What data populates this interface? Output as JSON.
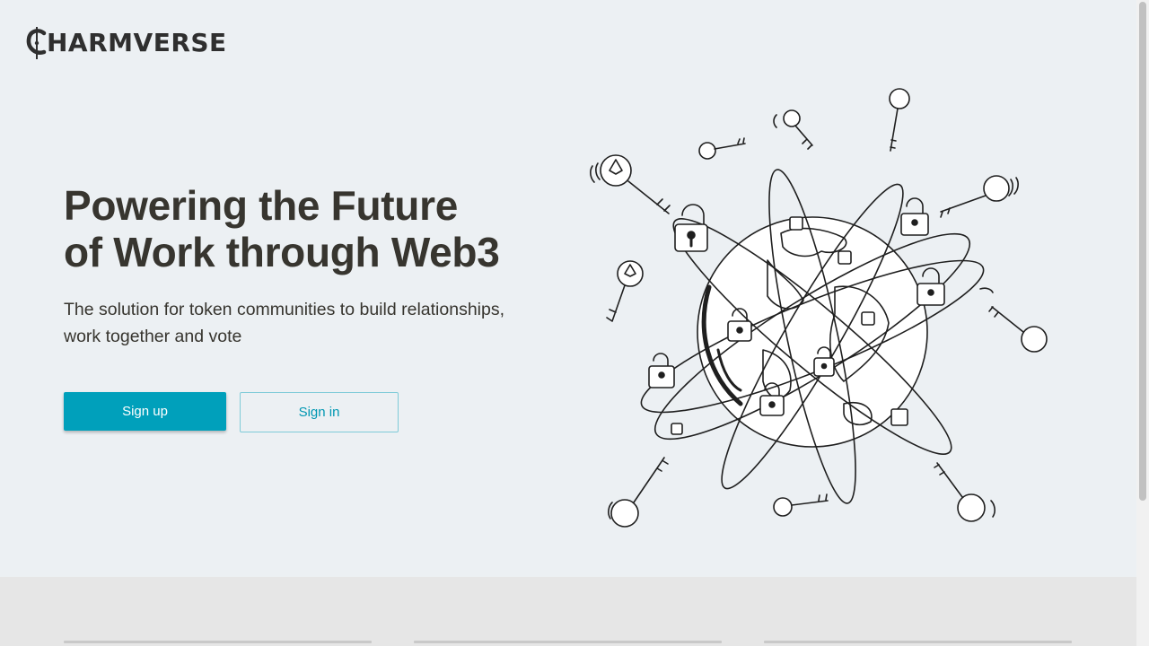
{
  "brand": {
    "logo_text": "HARMVERSE"
  },
  "hero": {
    "headline_line1": "Powering the Future",
    "headline_line2": "of Work through Web3",
    "subhead_line1": "The solution for token communities to build relationships,",
    "subhead_line2": "work together and vote",
    "signup_label": "Sign up",
    "signin_label": "Sign in",
    "illustration_icon": "globe-with-keys-and-locks-icon"
  },
  "colors": {
    "page_bg": "#ecf0f3",
    "footer_bg": "#e6e6e6",
    "text": "#37352f",
    "accent": "#00a0bb",
    "accent_border": "#7fcbd8"
  }
}
